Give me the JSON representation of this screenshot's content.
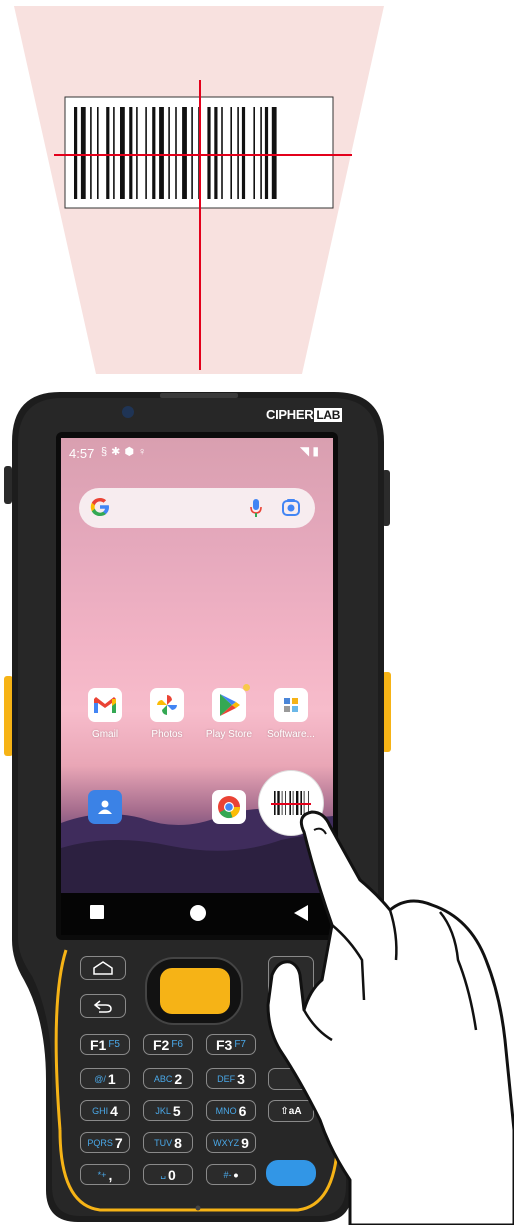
{
  "scene": {
    "description_colors": {
      "beam": "#f8e1df",
      "laser": "#e3001b",
      "device_body": "#1e1e1e",
      "accent_yellow": "#f6b316",
      "accent_blue": "#3296e6"
    }
  },
  "device": {
    "brand_main": "CIPHER",
    "brand_box": "LAB"
  },
  "status_bar": {
    "time": "4:57",
    "left_icons": [
      "sim-icon",
      "gear-icon",
      "shield-icon",
      "mic-icon"
    ],
    "right_icons": [
      "wifi-icon",
      "battery-icon"
    ]
  },
  "search": {
    "logo": "G",
    "icons": [
      "mic-icon",
      "camera-lens-icon"
    ]
  },
  "apps": [
    {
      "label": "Gmail",
      "icon": "gmail-icon"
    },
    {
      "label": "Photos",
      "icon": "photos-icon"
    },
    {
      "label": "Play Store",
      "icon": "play-store-icon"
    },
    {
      "label": "Software...",
      "icon": "software-icon"
    }
  ],
  "dock": [
    {
      "icon": "contacts-icon"
    },
    {
      "icon": "chrome-icon"
    },
    {
      "icon": "barcode-scanner-icon"
    }
  ],
  "nav": [
    "recents-square-icon",
    "home-circle-icon",
    "back-triangle-icon"
  ],
  "keypad": {
    "home_icon": "home-key-icon",
    "back_icon": "back-key-icon",
    "f_keys": [
      {
        "main": "F1",
        "sub": "F5"
      },
      {
        "main": "F2",
        "sub": "F6"
      },
      {
        "main": "F3",
        "sub": "F7"
      }
    ],
    "num_rows": [
      [
        {
          "sub": "@/",
          "main": "1"
        },
        {
          "sub": "ABC",
          "main": "2"
        },
        {
          "sub": "DEF",
          "main": "3"
        }
      ],
      [
        {
          "sub": "GHI",
          "main": "4"
        },
        {
          "sub": "JKL",
          "main": "5"
        },
        {
          "sub": "MNO",
          "main": "6"
        }
      ],
      [
        {
          "sub": "PQRS",
          "main": "7"
        },
        {
          "sub": "TUV",
          "main": "8"
        },
        {
          "sub": "WXYZ",
          "main": "9"
        }
      ],
      [
        {
          "sub": "*+",
          "main": ","
        },
        {
          "sub": "␣",
          "main": "0"
        },
        {
          "sub": "#-",
          "main": "•"
        }
      ]
    ],
    "shift_label": "⇧aA"
  }
}
